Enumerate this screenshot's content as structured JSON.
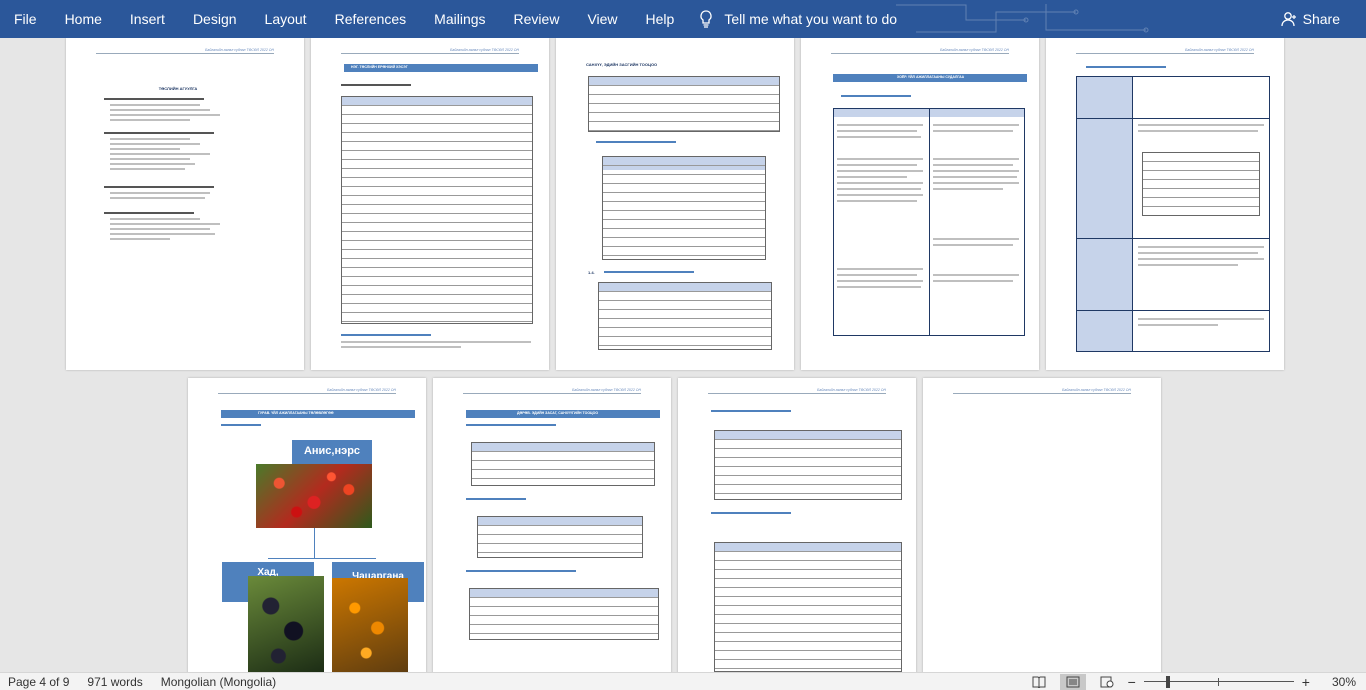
{
  "ribbon": {
    "tabs": [
      "File",
      "Home",
      "Insert",
      "Design",
      "Layout",
      "References",
      "Mailings",
      "Review",
      "View",
      "Help"
    ],
    "tell_me": "Tell me what you want to do",
    "share": "Share"
  },
  "pages": {
    "header_text": "Байгалийн аялал судлал  ТӨСӨЛ  2022 ОН",
    "page1_title": "ТӨСЛИЙН АГУУЛГА",
    "page2_title": "НЭГ. ТӨСЛИЙН ЕРӨНХИЙ ХЭСЭГ",
    "page3_title": "САНХҮҮ, ЭДИЙН ЗАСГИЙН ТООЦОО",
    "page4_title": "ХОЁР. ҮЙЛ АЖИЛЛАГААНЫ СУДАЛГАА",
    "page6_title": "ГУРАВ. ҮЙЛ АЖИЛЛАГААНЫ ТӨЛӨВЛӨГӨӨ",
    "page7_title": "ДӨРӨВ. ЭДИЙН ЗАСАГ, САНХҮҮГИЙН ТООЦОО",
    "org_root": "Анис,нэрс",
    "org_left": "Хад,",
    "org_right": "Чацаргана"
  },
  "status": {
    "page": "Page 4 of 9",
    "words": "971 words",
    "language": "Mongolian (Mongolia)",
    "zoom": "30%"
  },
  "colors": {
    "ribbon": "#2b579a",
    "accent": "#4f81bd"
  }
}
